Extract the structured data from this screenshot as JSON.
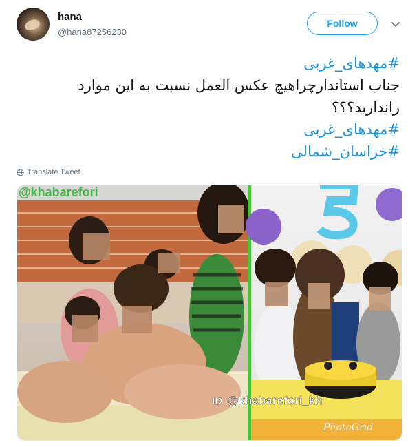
{
  "user": {
    "display_name": "hana",
    "handle": "@hana87256230",
    "avatar_icon": "avatar-image"
  },
  "actions": {
    "follow_label": "Follow",
    "menu_icon": "chevron-down-icon"
  },
  "tweet": {
    "lines": [
      "#مهدهای_غربی",
      "جناب استاندارچراهیچ عکس العمل نسبت به این موارد",
      "راندارید؟؟؟",
      "#مهدهای_غربی",
      "#خراسان_شمالی"
    ],
    "translate_label": "Translate Tweet"
  },
  "media": {
    "watermark_top": "@khabarefori",
    "watermark_id": "ID",
    "watermark_handle": "@khabarefori_kh",
    "watermark_grid": "PhotoGrid"
  },
  "colors": {
    "accent": "#1da1f2",
    "hashtag": "#1b95e0",
    "divider_green": "#4cc13a"
  }
}
